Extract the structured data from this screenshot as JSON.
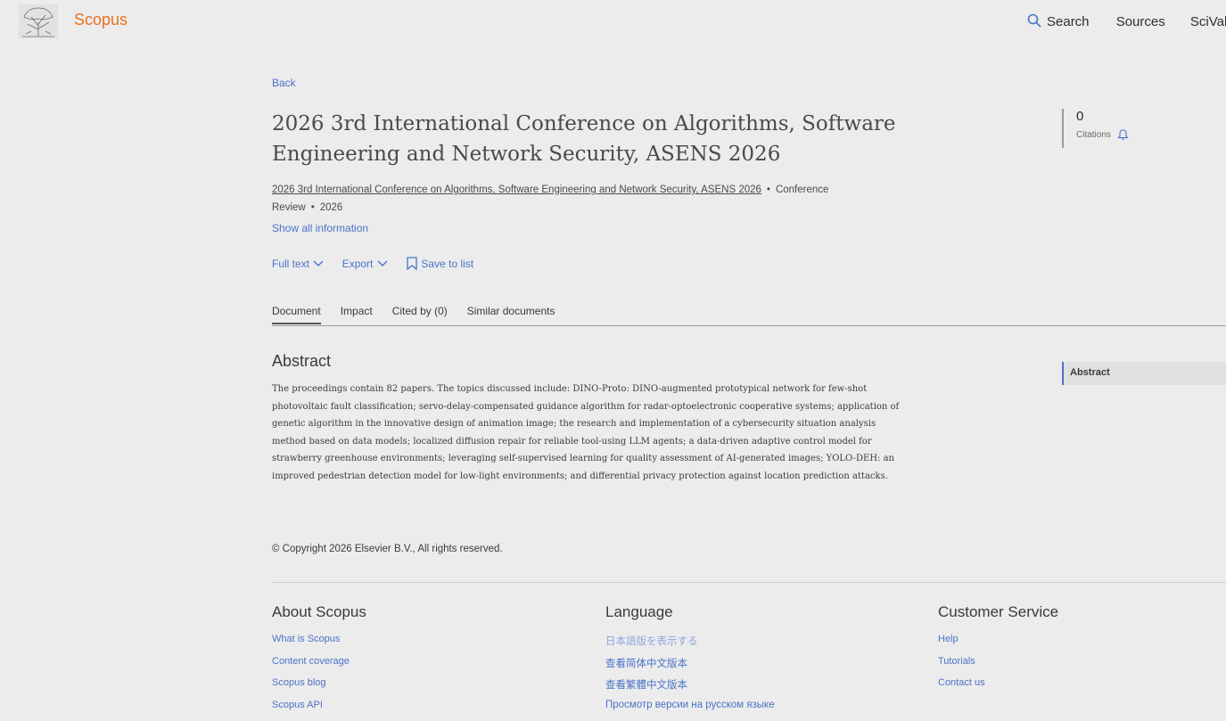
{
  "header": {
    "brand": "Scopus",
    "nav": {
      "search": "Search",
      "sources": "Sources",
      "scival": "SciVal ↗"
    }
  },
  "back_label": "Back",
  "document": {
    "title": "2026 3rd International Conference on Algorithms, Software Engineering and Network Security, ASENS 2026",
    "source_title": "2026 3rd International Conference on Algorithms, Software Engineering and Network Security, ASENS 2026",
    "doc_type": "Conference Review",
    "year": "2026",
    "show_all": "Show all information"
  },
  "actions": {
    "full_text": "Full text",
    "export": "Export",
    "save": "Save to list"
  },
  "citations": {
    "count": "0",
    "label": "Citations"
  },
  "tabs": [
    {
      "label": "Document"
    },
    {
      "label": "Impact"
    },
    {
      "label": "Cited by (0)"
    },
    {
      "label": "Similar documents"
    }
  ],
  "abstract": {
    "heading": "Abstract",
    "text": "The proceedings contain 82 papers. The topics discussed include: DINO-Proto: DINO-augmented prototypical network for few-shot photovoltaic fault classification; servo-delay-compensated guidance algorithm for radar-optoelectronic cooperative systems; application of genetic algorithm in the innovative design of animation image; the research and implementation of a cybersecurity situation analysis method based on data models; localized diffusion repair for reliable tool-using LLM agents; a data-driven adaptive control model for strawberry greenhouse environments; leveraging self-supervised learning for quality assessment of AI-generated images; YOLO-DEH: an improved pedestrian detection model for low-light environments; and differential privacy protection against location prediction attacks."
  },
  "toc": {
    "item": "Abstract"
  },
  "copyright": "© Copyright 2026 Elsevier B.V., All rights reserved.",
  "footer": {
    "about": {
      "heading": "About Scopus",
      "links": [
        "What is Scopus",
        "Content coverage",
        "Scopus blog",
        "Scopus API"
      ]
    },
    "language": {
      "heading": "Language",
      "links": [
        "日本語版を表示する",
        "查看简体中文版本",
        "查看繁體中文版本",
        "Просмотр версии на русском языке"
      ]
    },
    "service": {
      "heading": "Customer Service",
      "links": [
        "Help",
        "Tutorials",
        "Contact us"
      ]
    }
  },
  "colors": {
    "accent": "#4a73c7",
    "brand": "#e9711c",
    "background": "#ececec"
  }
}
